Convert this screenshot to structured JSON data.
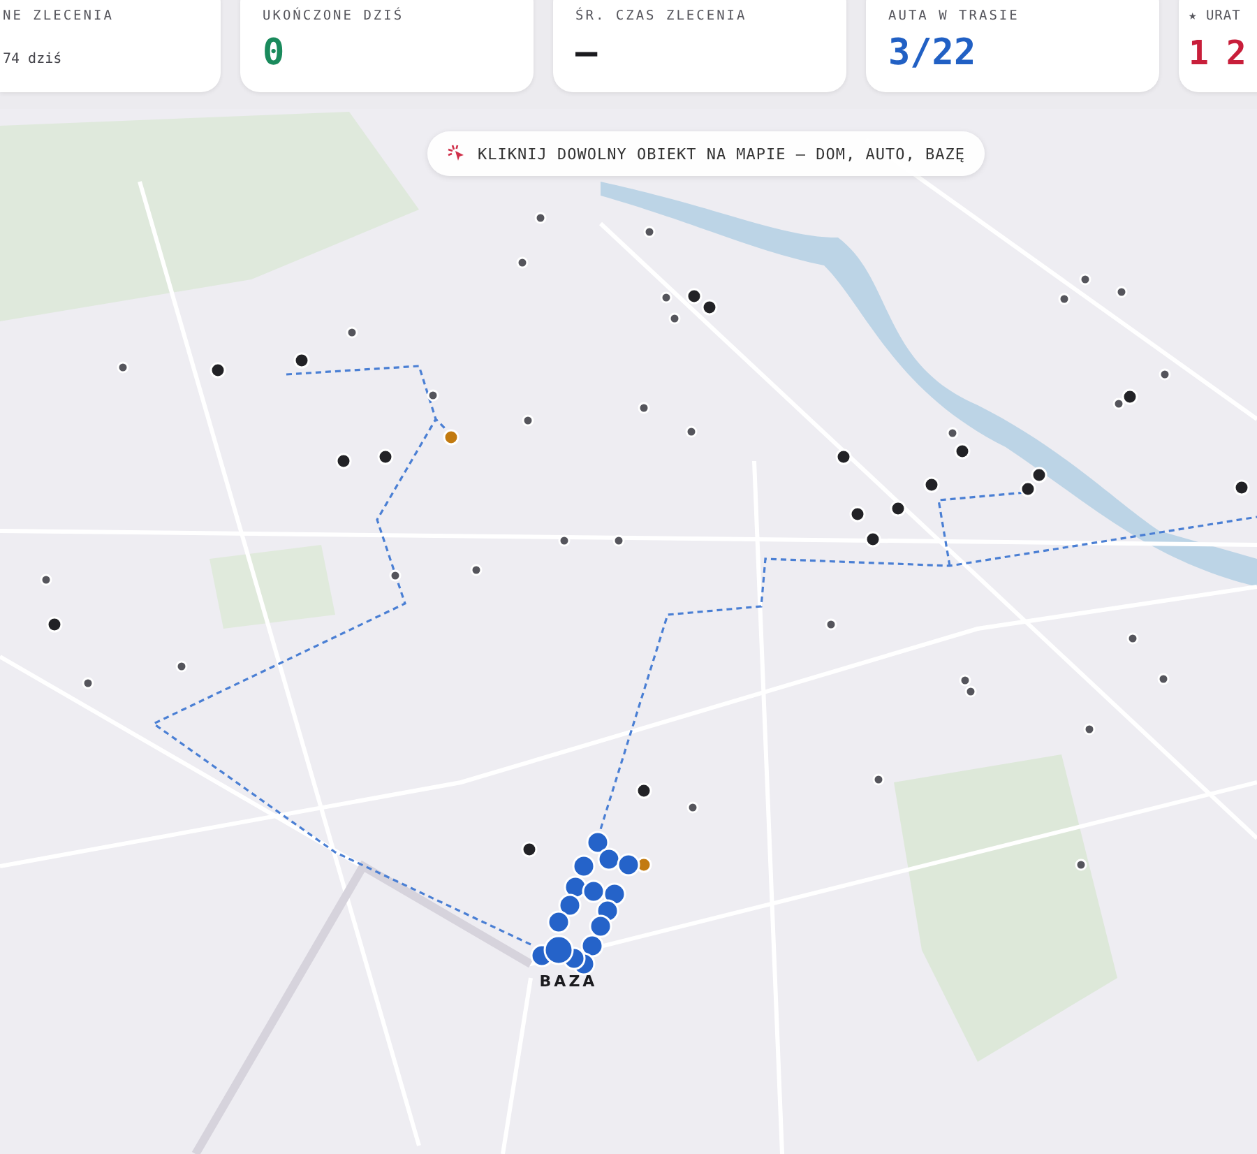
{
  "stats": [
    {
      "label": "NE ZLECENIA",
      "note": "74 dziś"
    },
    {
      "label": "UKOŃCZONE DZIŚ",
      "value": "0",
      "color": "#1a8a5c"
    },
    {
      "label": "ŚR. CZAS ZLECENIA",
      "value": "—",
      "color": "#1b1b1f"
    },
    {
      "label": "AUTA W TRASIE",
      "value": "3/22",
      "color": "#2160c4"
    },
    {
      "label": "★ URAT",
      "value": "1 2",
      "color": "#c81e3a"
    }
  ],
  "map": {
    "hint": "KLIKNIJ DOWOLNY OBIEKT NA MAPIE — DOM, AUTO, BAZĘ",
    "base_label": "BAZA",
    "markers": [
      {
        "kind": "active"
      },
      {
        "kind": "active"
      },
      {
        "kind": "active"
      },
      {
        "kind": "active"
      },
      {
        "kind": "active"
      },
      {
        "kind": "active"
      },
      {
        "kind": "active"
      },
      {
        "kind": "active"
      },
      {
        "kind": "active"
      },
      {
        "kind": "active"
      },
      {
        "kind": "active"
      },
      {
        "kind": "active"
      },
      {
        "kind": "active"
      },
      {
        "kind": "active"
      },
      {
        "kind": "active"
      },
      {
        "kind": "active"
      },
      {
        "kind": "active"
      },
      {
        "kind": "active"
      },
      {
        "kind": "active"
      },
      {
        "kind": "idle"
      },
      {
        "kind": "idle"
      },
      {
        "kind": "idle"
      },
      {
        "kind": "idle"
      },
      {
        "kind": "idle"
      },
      {
        "kind": "idle"
      },
      {
        "kind": "idle"
      },
      {
        "kind": "idle"
      },
      {
        "kind": "idle"
      },
      {
        "kind": "idle"
      },
      {
        "kind": "idle"
      },
      {
        "kind": "idle"
      },
      {
        "kind": "idle"
      },
      {
        "kind": "idle"
      },
      {
        "kind": "idle"
      },
      {
        "kind": "idle"
      },
      {
        "kind": "idle"
      },
      {
        "kind": "idle"
      },
      {
        "kind": "idle"
      },
      {
        "kind": "idle"
      },
      {
        "kind": "idle"
      },
      {
        "kind": "idle"
      },
      {
        "kind": "idle"
      },
      {
        "kind": "idle"
      },
      {
        "kind": "idle"
      },
      {
        "kind": "idle"
      },
      {
        "kind": "idle"
      },
      {
        "kind": "idle"
      },
      {
        "kind": "idle"
      },
      {
        "kind": "idle"
      },
      {
        "kind": "idle"
      },
      {
        "kind": "idle"
      },
      {
        "kind": "idle"
      },
      {
        "kind": "waiting"
      },
      {
        "kind": "waiting"
      },
      {
        "kind": "car"
      },
      {
        "kind": "car"
      },
      {
        "kind": "car"
      },
      {
        "kind": "car"
      },
      {
        "kind": "car"
      },
      {
        "kind": "car"
      },
      {
        "kind": "car"
      },
      {
        "kind": "car"
      },
      {
        "kind": "car"
      },
      {
        "kind": "car"
      },
      {
        "kind": "car"
      },
      {
        "kind": "car"
      },
      {
        "kind": "car"
      },
      {
        "kind": "car"
      },
      {
        "kind": "car"
      },
      {
        "kind": "base"
      }
    ]
  }
}
